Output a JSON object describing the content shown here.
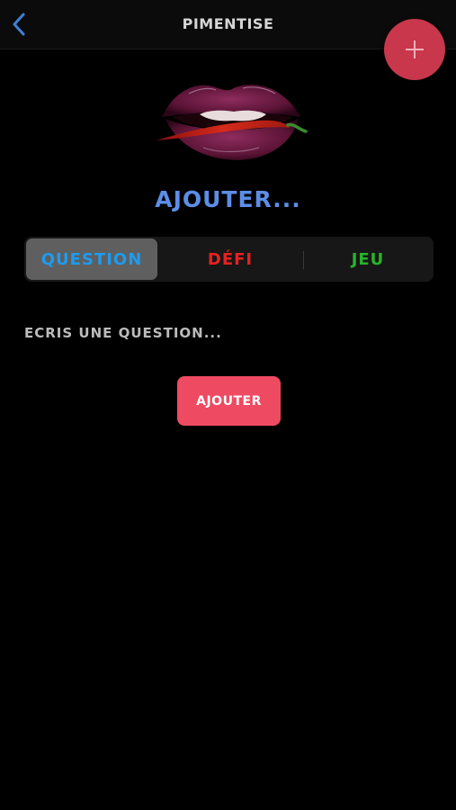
{
  "header": {
    "title": "PIMENTISE",
    "back_icon": "chevron-left-icon",
    "fab_icon": "plus-icon"
  },
  "logo": {
    "icon": "lips-with-chili-pepper-logo"
  },
  "heading": "AJOUTER...",
  "tabs": [
    {
      "label": "QUESTION",
      "color": "#1e9bf0",
      "selected": true
    },
    {
      "label": "DÉFI",
      "color": "#e82020",
      "selected": false
    },
    {
      "label": "JEU",
      "color": "#27b32a",
      "selected": false
    }
  ],
  "input": {
    "placeholder": "ECRIS UNE QUESTION...",
    "value": ""
  },
  "submit_label": "AJOUTER",
  "colors": {
    "background": "#000000",
    "nav_bar": "#0b0b0b",
    "heading": "#5d8ee6",
    "back_icon": "#3f7fd9",
    "fab": "#c8374b",
    "submit_button": "#ee4a62",
    "segment_selected": "#5f5f5f"
  }
}
